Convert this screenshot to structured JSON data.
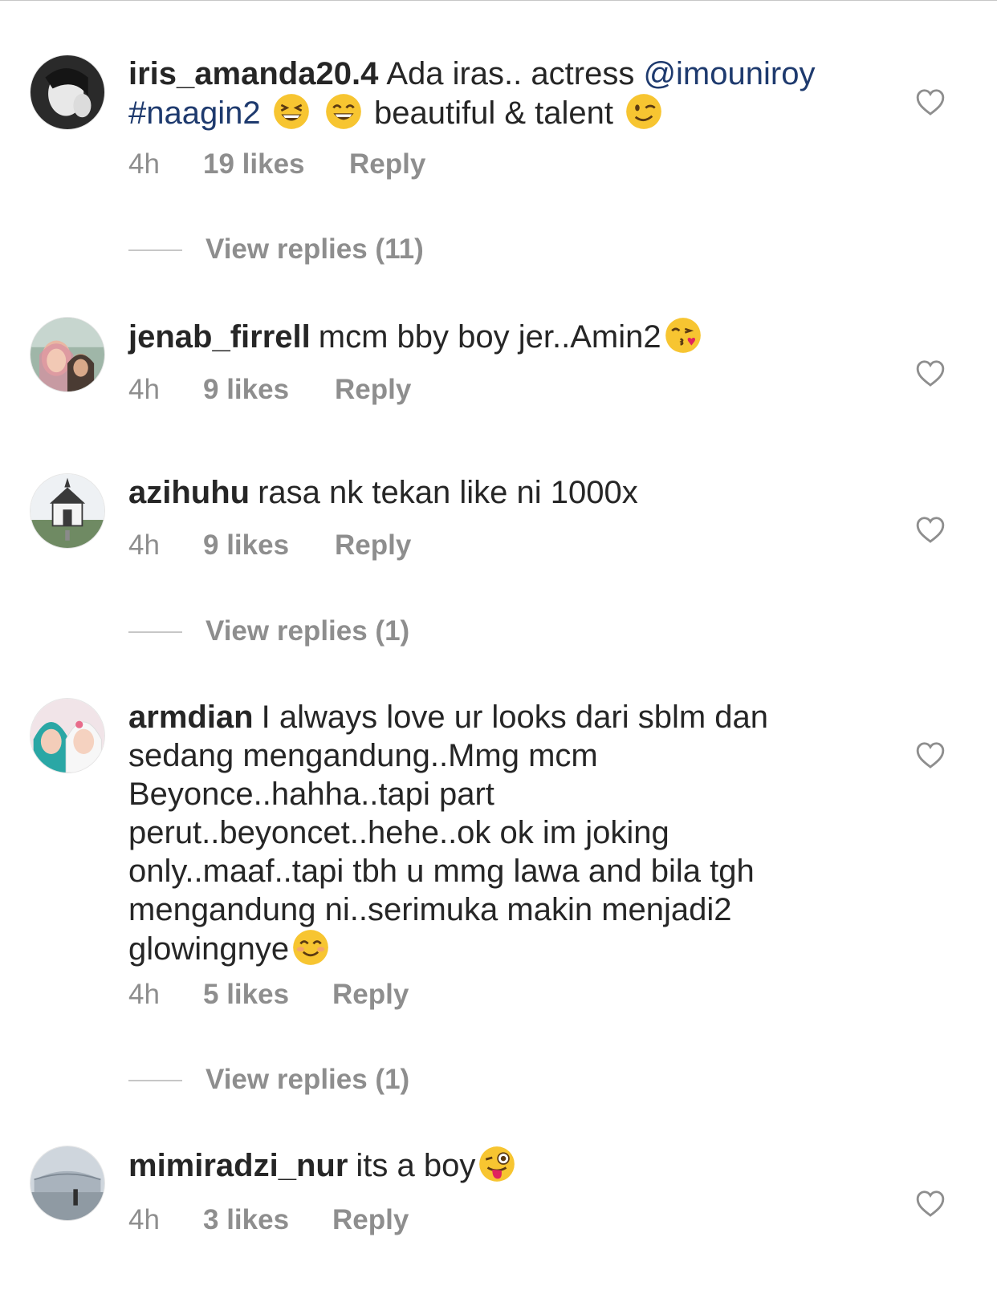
{
  "comments": [
    {
      "username": "iris_amanda20.4",
      "text_parts": [
        "Ada iras.. actress ",
        "@imouniroy",
        "#naagin2",
        "beautiful & talent"
      ],
      "time": "4h",
      "likes": "19 likes",
      "reply": "Reply",
      "view_replies": "View replies (11)",
      "emojis": [
        "grinning-squinting-face",
        "grinning-face-smiling-eyes",
        "winking-face"
      ]
    },
    {
      "username": "jenab_firrell",
      "text": "mcm bby boy jer..Amin2",
      "time": "4h",
      "likes": "9 likes",
      "reply": "Reply",
      "emojis": [
        "face-blowing-kiss"
      ]
    },
    {
      "username": "azihuhu",
      "text": "rasa nk tekan like ni 1000x",
      "time": "4h",
      "likes": "9 likes",
      "reply": "Reply",
      "view_replies": "View replies (1)"
    },
    {
      "username": "armdian",
      "text": "I always love ur looks dari sblm dan sedang mengandung..Mmg mcm Beyonce..hahha..tapi part perut..beyoncet..hehe..ok ok im joking only..maaf..tapi tbh u mmg lawa and bila tgh mengandung ni..serimuka makin menjadi2 glowingnye",
      "time": "4h",
      "likes": "5 likes",
      "reply": "Reply",
      "view_replies": "View replies (1)",
      "emojis": [
        "smiling-face-smiling-eyes"
      ]
    },
    {
      "username": "mimiradzi_nur",
      "text": "its a boy",
      "time": "4h",
      "likes": "3 likes",
      "reply": "Reply",
      "emojis": [
        "winking-face-tongue"
      ]
    }
  ],
  "icons": {
    "like": "heart-outline-icon"
  },
  "colors": {
    "text": "#262626",
    "meta": "#8e8e8e",
    "link": "#1e3a6e",
    "emoji": "#f7c531"
  }
}
